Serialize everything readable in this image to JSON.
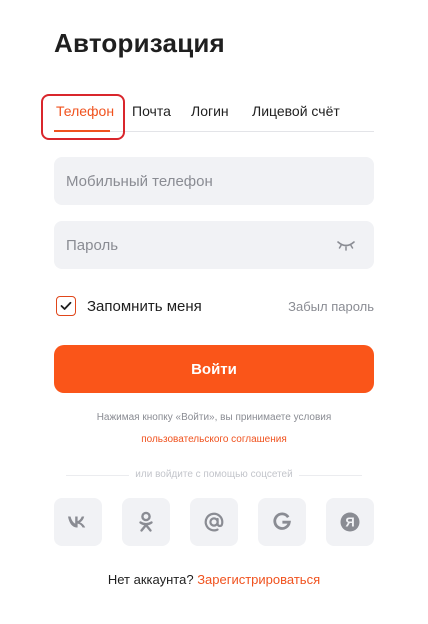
{
  "title": "Авторизация",
  "tabs": [
    {
      "label": "Телефон",
      "active": true
    },
    {
      "label": "Почта",
      "active": false
    },
    {
      "label": "Логин",
      "active": false
    },
    {
      "label": "Лицевой счёт",
      "active": false
    }
  ],
  "fields": {
    "phone": {
      "placeholder": "Мобильный телефон",
      "value": ""
    },
    "password": {
      "placeholder": "Пароль",
      "value": ""
    }
  },
  "remember": {
    "label": "Запомнить меня",
    "checked": true
  },
  "forgot_label": "Забыл пароль",
  "login_button": "Войти",
  "terms": {
    "text": "Нажимая кнопку «Войти», вы принимаете условия",
    "link": "пользовательского соглашения"
  },
  "divider_text": "или войдите с помощью соцсетей",
  "socials": [
    {
      "icon": "vk-icon"
    },
    {
      "icon": "odnoklassniki-icon"
    },
    {
      "icon": "mail-icon"
    },
    {
      "icon": "google-icon"
    },
    {
      "icon": "yandex-icon"
    }
  ],
  "signup": {
    "text": "Нет аккаунта?",
    "link": "Зарегистрироваться"
  },
  "colors": {
    "accent": "#fa5519",
    "accent_text": "#f0521e",
    "field_bg": "#f1f2f5",
    "muted": "#8a8c93",
    "highlight": "#d9262c"
  }
}
